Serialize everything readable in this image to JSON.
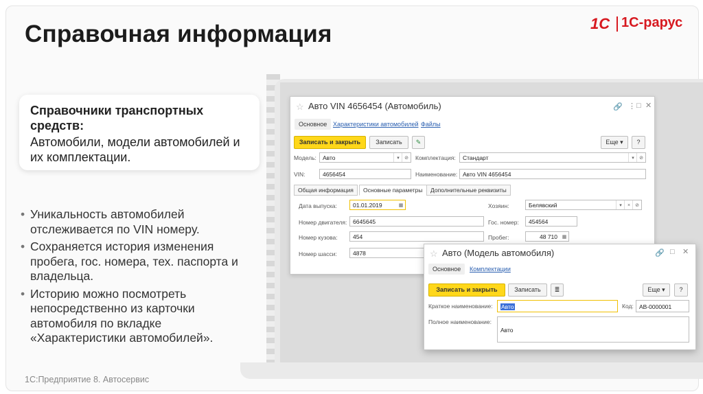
{
  "slide": {
    "title": "Справочная информация",
    "logo_1c": "1С",
    "logo_rarus": "1С-рарус",
    "callout_heading": "Справочники транспортных средств:",
    "callout_text": "Автомобили, модели автомобилей и их комплектации.",
    "bullets": [
      "Уникальность автомобилей отслеживается по VIN номеру.",
      "Сохраняется история изменения пробега, гос. номера, тех. паспорта и владельца.",
      "Историю можно посмотреть непосредственно из карточки автомобиля по вкладке «Характеристики автомобилей»."
    ],
    "footer": "1С:Предприятие 8. Автосервис"
  },
  "car_window": {
    "title": "Авто VIN 4656454 (Автомобиль)",
    "tabs": [
      "Основное",
      "Характеристики автомобилей",
      "Файлы"
    ],
    "btn_save_close": "Записать и закрыть",
    "btn_save": "Записать",
    "btn_more": "Еще",
    "btn_help": "?",
    "model_label": "Модель:",
    "model_value": "Авто",
    "config_label": "Комплектация:",
    "config_value": "Стандарт",
    "vin_label": "VIN:",
    "vin_value": "4656454",
    "name_label": "Наименование:",
    "name_value": "Авто VIN 4656454",
    "sections": [
      "Общая информация",
      "Основные параметры",
      "Дополнительные реквизиты"
    ],
    "release_label": "Дата выпуска:",
    "release_value": "01.01.2019",
    "engine_label": "Номер двигателя:",
    "engine_value": "6645645",
    "body_label": "Номер кузова:",
    "body_value": "454",
    "chassis_label": "Номер шасси:",
    "chassis_value": "4878",
    "owner_label": "Хозяин:",
    "owner_value": "Белявский",
    "plate_label": "Гос. номер:",
    "plate_value": "454564",
    "mileage_label": "Пробег:",
    "mileage_value": "48 710"
  },
  "model_window": {
    "title": "Авто (Модель автомобиля)",
    "tabs": [
      "Основное",
      "Комплектации"
    ],
    "btn_save_close": "Записать и закрыть",
    "btn_save": "Записать",
    "btn_more": "Еще",
    "btn_help": "?",
    "short_label": "Краткое наименование:",
    "short_value": "Авто",
    "code_label": "Код:",
    "code_value": "АВ-0000001",
    "full_label": "Полное наименование:",
    "full_value": "Авто"
  },
  "colors": {
    "brand": "#d71920",
    "primary_button": "#ffd71a",
    "link": "#2a5fb0"
  }
}
